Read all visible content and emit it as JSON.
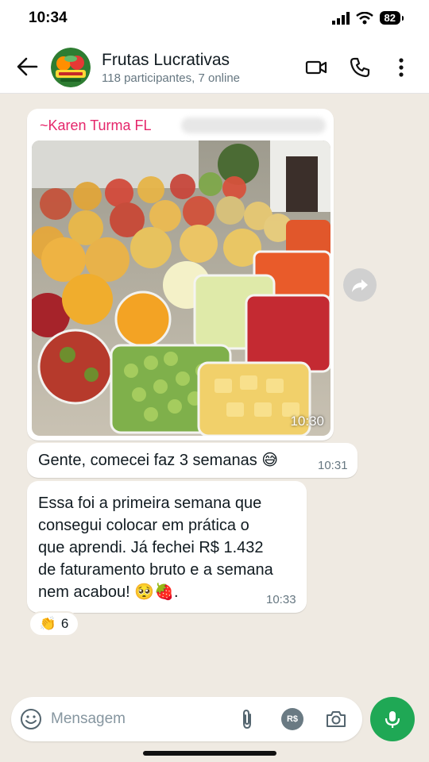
{
  "status_bar": {
    "time": "10:34",
    "battery": "82"
  },
  "header": {
    "title": "Frutas Lucrativas",
    "subtitle": "118 participantes, 7 online",
    "avatar_icon": "fruit-logo-icon",
    "icons": [
      "back-arrow-icon",
      "video-call-icon",
      "phone-icon",
      "more-vert-icon"
    ]
  },
  "messages": [
    {
      "type": "image",
      "sender": "~Karen Turma FL",
      "time": "10:30",
      "image_desc_icon": "fruit-cups-photo"
    },
    {
      "type": "text",
      "text": "Gente, comecei faz 3 semanas 😅",
      "time": "10:31"
    },
    {
      "type": "text",
      "lines": [
        "Essa foi a primeira semana que",
        "consegui colocar em prática o",
        "que aprendi. Já fechei R$ 1.432",
        "de faturamento bruto e a semana",
        "nem acabou! 🥺🍓."
      ],
      "time": "10:33"
    }
  ],
  "reaction": {
    "emoji": "👏",
    "count": "6"
  },
  "composer": {
    "placeholder": "Mensagem",
    "currency_label": "R$"
  },
  "colors": {
    "accent": "#1fa855",
    "sender": "#e5266b",
    "chat_bg": "#efeae2"
  }
}
